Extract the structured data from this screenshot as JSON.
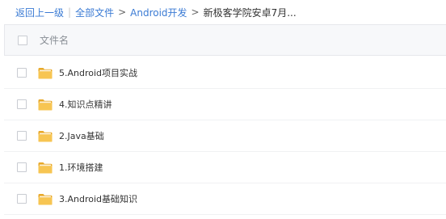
{
  "breadcrumb": {
    "back": "返回上一级",
    "separator_bar": "|",
    "all_files": "全部文件",
    "arrow1": ">",
    "folder1": "Android开发",
    "arrow2": ">",
    "current": "新极客学院安卓7月..."
  },
  "header": {
    "column_name": "文件名"
  },
  "files": [
    {
      "name": "5.Android项目实战",
      "icon": "folder-icon"
    },
    {
      "name": "4.知识点精讲",
      "icon": "folder-icon"
    },
    {
      "name": "2.Java基础",
      "icon": "folder-icon"
    },
    {
      "name": "1.环境搭建",
      "icon": "folder-icon"
    },
    {
      "name": "3.Android基础知识",
      "icon": "folder-icon"
    }
  ],
  "colors": {
    "link": "#3b7bd4",
    "folder": "#f5c04a",
    "header_bg": "#f7f8fa"
  }
}
